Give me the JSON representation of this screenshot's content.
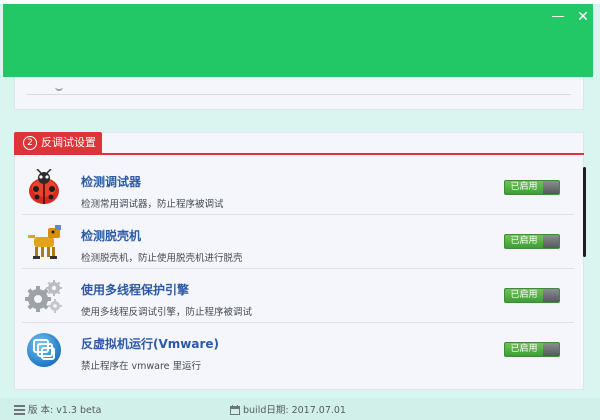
{
  "window": {
    "minimize_glyph": "—",
    "close_glyph": "✕",
    "colors": {
      "header": "#22c865",
      "tag": "#df3437",
      "toggle_on": "#4fae3f"
    }
  },
  "section": {
    "number": "2",
    "title": "反调试设置"
  },
  "items": [
    {
      "title": "检测调试器",
      "desc": "检测常用调试器，防止程序被调试",
      "status": "已启用",
      "icon": "ladybug-icon"
    },
    {
      "title": "检测脱壳机",
      "desc": "检测脱壳机，防止使用脱壳机进行脱壳",
      "status": "已启用",
      "icon": "robot-dog-icon"
    },
    {
      "title": "使用多线程保护引擎",
      "desc": "使用多线程反调试引擎，防止程序被调试",
      "status": "已启用",
      "icon": "gears-icon"
    },
    {
      "title": "反虚拟机运行(Vmware)",
      "desc": "禁止程序在 vmware 里运行",
      "status": "已启用",
      "icon": "vmware-icon"
    }
  ],
  "status": {
    "version": "版 本: v1.3 beta",
    "build": "build日期: 2017.07.01"
  }
}
